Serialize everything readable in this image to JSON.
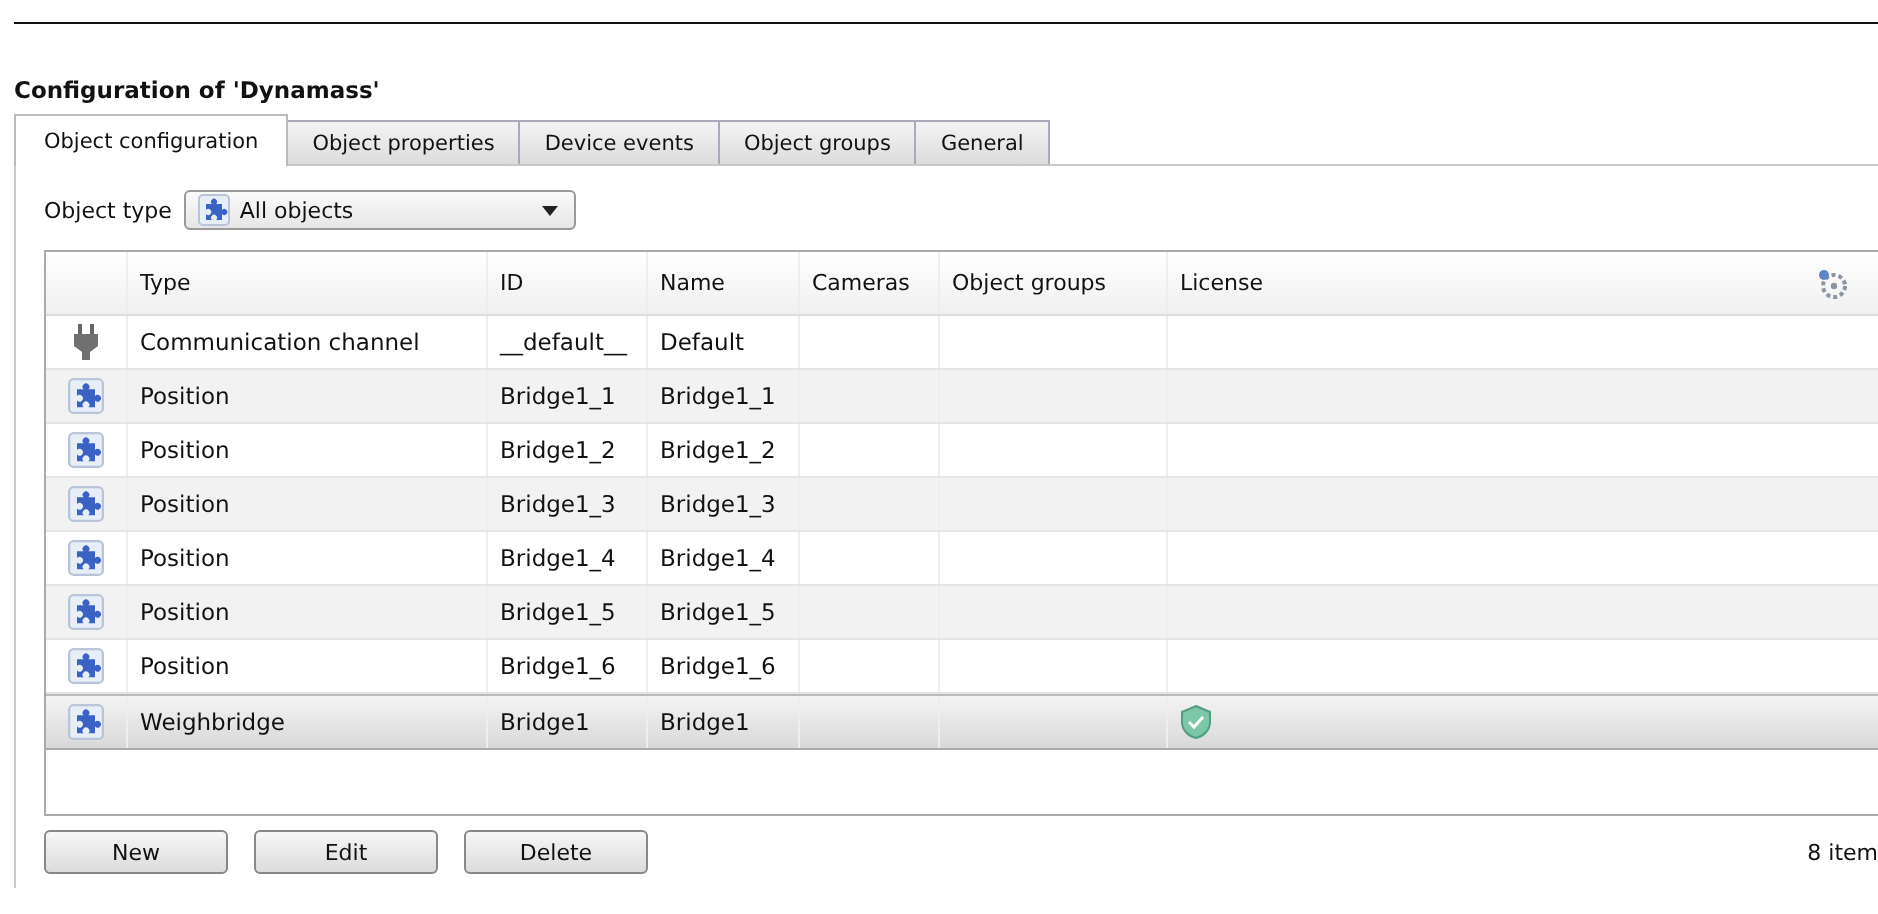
{
  "title": "Configuration of 'Dynamass'",
  "tabs": [
    {
      "label": "Object configuration",
      "selected": true
    },
    {
      "label": "Object properties",
      "selected": false
    },
    {
      "label": "Device events",
      "selected": false
    },
    {
      "label": "Object groups",
      "selected": false
    },
    {
      "label": "General",
      "selected": false
    }
  ],
  "object_type": {
    "label": "Object type",
    "value": "All objects"
  },
  "table": {
    "columns": [
      "Type",
      "ID",
      "Name",
      "Cameras",
      "Object groups",
      "License"
    ],
    "rows": [
      {
        "kind": "channel",
        "type": "Communication channel",
        "id": "__default__",
        "name": "Default",
        "licensed": false,
        "selected": false
      },
      {
        "kind": "object",
        "type": "Position",
        "id": "Bridge1_1",
        "name": "Bridge1_1",
        "licensed": false,
        "selected": false
      },
      {
        "kind": "object",
        "type": "Position",
        "id": "Bridge1_2",
        "name": "Bridge1_2",
        "licensed": false,
        "selected": false
      },
      {
        "kind": "object",
        "type": "Position",
        "id": "Bridge1_3",
        "name": "Bridge1_3",
        "licensed": false,
        "selected": false
      },
      {
        "kind": "object",
        "type": "Position",
        "id": "Bridge1_4",
        "name": "Bridge1_4",
        "licensed": false,
        "selected": false
      },
      {
        "kind": "object",
        "type": "Position",
        "id": "Bridge1_5",
        "name": "Bridge1_5",
        "licensed": false,
        "selected": false
      },
      {
        "kind": "object",
        "type": "Position",
        "id": "Bridge1_6",
        "name": "Bridge1_6",
        "licensed": false,
        "selected": false
      },
      {
        "kind": "object",
        "type": "Weighbridge",
        "id": "Bridge1",
        "name": "Bridge1",
        "licensed": true,
        "selected": true
      }
    ]
  },
  "buttons": [
    "New",
    "Edit",
    "Delete"
  ],
  "item_count": "8 item"
}
